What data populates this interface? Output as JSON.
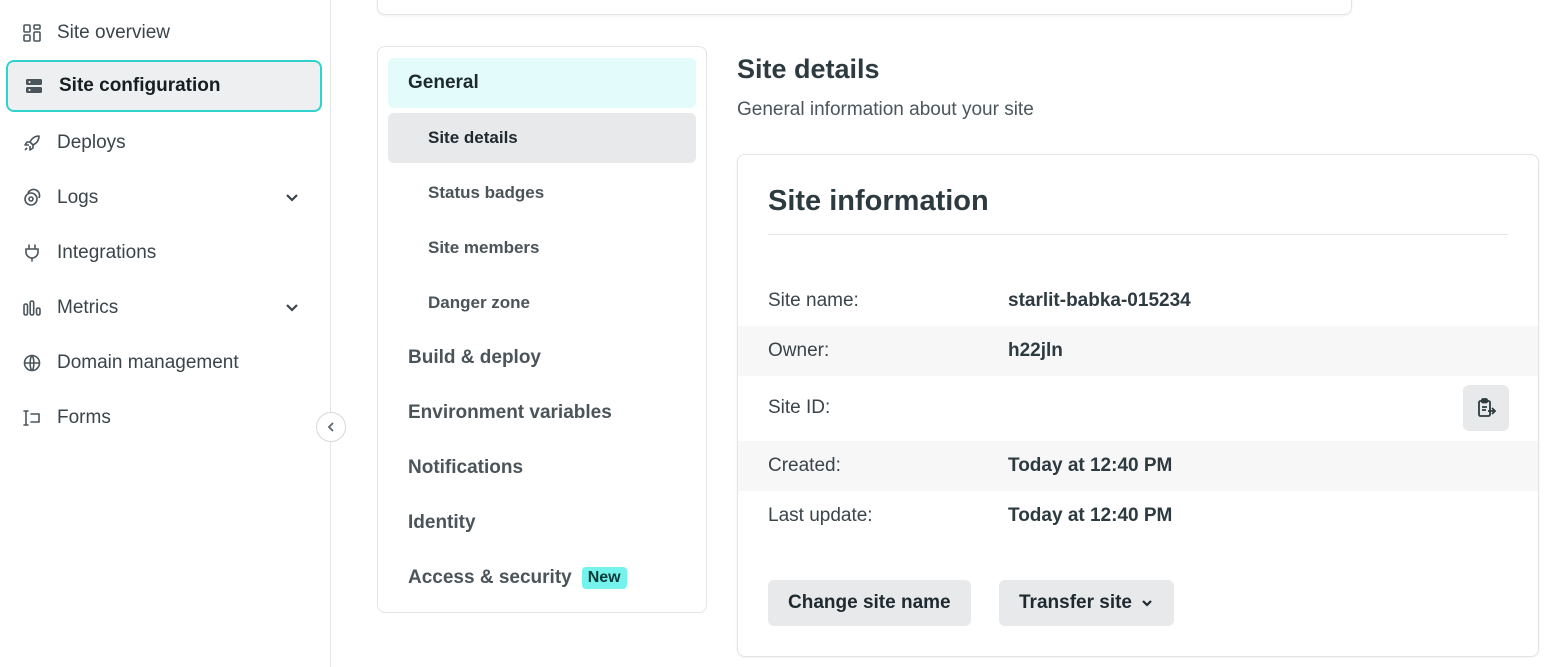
{
  "sidebar": {
    "items": [
      {
        "label": "Site overview",
        "icon": "grid-icon"
      },
      {
        "label": "Site configuration",
        "icon": "server-icon",
        "active": true
      },
      {
        "label": "Deploys",
        "icon": "rocket-icon"
      },
      {
        "label": "Logs",
        "icon": "logs-icon",
        "expandable": true
      },
      {
        "label": "Integrations",
        "icon": "plug-icon"
      },
      {
        "label": "Metrics",
        "icon": "bar-chart-icon",
        "expandable": true
      },
      {
        "label": "Domain management",
        "icon": "globe-icon"
      },
      {
        "label": "Forms",
        "icon": "form-icon"
      }
    ]
  },
  "subnav": {
    "general": "General",
    "site_details": "Site details",
    "status_badges": "Status badges",
    "site_members": "Site members",
    "danger_zone": "Danger zone",
    "build_deploy": "Build & deploy",
    "env_vars": "Environment variables",
    "notifications": "Notifications",
    "identity": "Identity",
    "access_security": "Access & security",
    "new_badge": "New"
  },
  "main": {
    "title": "Site details",
    "subtitle": "General information about your site"
  },
  "card": {
    "title": "Site information",
    "rows": [
      {
        "label": "Site name:",
        "value": "starlit-babka-015234"
      },
      {
        "label": "Owner:",
        "value": "h22jln"
      },
      {
        "label": "Site ID:",
        "value": ""
      },
      {
        "label": "Created:",
        "value": "Today at 12:40 PM"
      },
      {
        "label": "Last update:",
        "value": "Today at 12:40 PM"
      }
    ],
    "change_name_button": "Change site name",
    "transfer_button": "Transfer site"
  },
  "colors": {
    "accent": "#30d3cb",
    "accent_light": "#e3fcfb",
    "badge": "#73f3ec"
  }
}
